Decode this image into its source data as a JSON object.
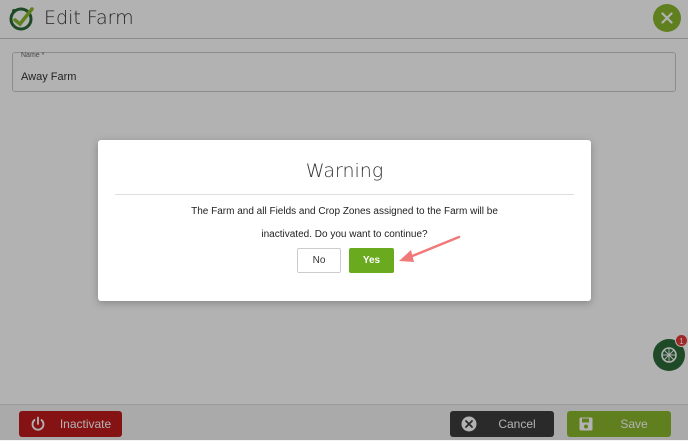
{
  "header": {
    "title": "Edit Farm"
  },
  "form": {
    "name_label": "Name *",
    "name_value": "Away Farm"
  },
  "footer": {
    "inactivate_label": "Inactivate",
    "cancel_label": "Cancel",
    "save_label": "Save"
  },
  "helper": {
    "badge_count": "1"
  },
  "dialog": {
    "title": "Warning",
    "message_line1": "The Farm and all Fields and Crop Zones assigned to the Farm will be",
    "message_line2": "inactivated. Do you want to continue?",
    "no_label": "No",
    "yes_label": "Yes"
  },
  "colors": {
    "accent_green": "#8ab82e",
    "danger_red": "#c11c1c",
    "annotation_arrow": "#f07a7a"
  },
  "icons": [
    "farm-logo-icon",
    "close-icon",
    "power-icon",
    "cancel-x-icon",
    "save-floppy-icon",
    "help-widget-icon",
    "annotation-arrow"
  ]
}
